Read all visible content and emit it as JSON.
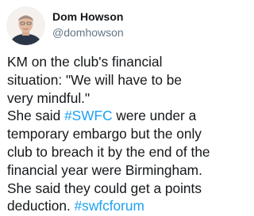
{
  "colors": {
    "text": "#14171a",
    "secondary": "#657786",
    "hashtag": "#1da1f2",
    "background": "#ffffff"
  },
  "tweet": {
    "author_name": "Dom Howson",
    "author_handle": "@domhowson",
    "avatar_icon": "profile-photo",
    "lines": [
      [
        {
          "text": "KM on the club's financial"
        }
      ],
      [
        {
          "text": "situation: \"We will have to be"
        }
      ],
      [
        {
          "text": "very mindful.\""
        }
      ],
      [
        {
          "text": "She said "
        },
        {
          "text": "#SWFC",
          "hashtag": true
        },
        {
          "text": " were under a"
        }
      ],
      [
        {
          "text": "temporary embargo but the only"
        }
      ],
      [
        {
          "text": "club to breach it by the end of the"
        }
      ],
      [
        {
          "text": "financial year were Birmingham."
        }
      ],
      [
        {
          "text": "She said they could get a points"
        }
      ],
      [
        {
          "text": "deduction. "
        },
        {
          "text": "#swfcforum",
          "hashtag": true
        }
      ]
    ]
  }
}
